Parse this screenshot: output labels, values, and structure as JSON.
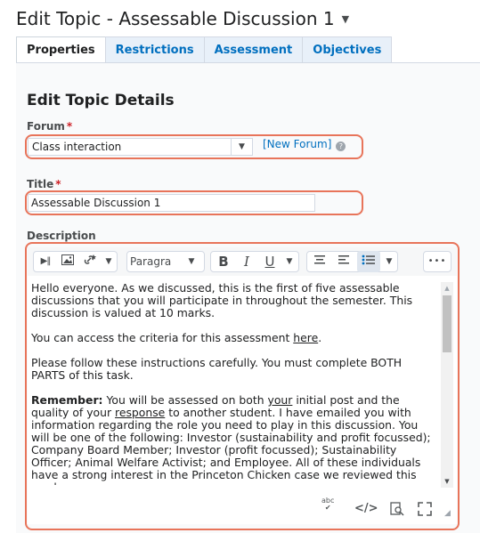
{
  "page": {
    "title": "Edit Topic - Assessable Discussion 1",
    "title_caret": "▼"
  },
  "tabs": [
    {
      "label": "Properties",
      "active": true
    },
    {
      "label": "Restrictions",
      "active": false
    },
    {
      "label": "Assessment",
      "active": false
    },
    {
      "label": "Objectives",
      "active": false
    }
  ],
  "section": {
    "heading": "Edit Topic Details"
  },
  "forum": {
    "label": "Forum",
    "required_mark": "*",
    "selected": "Class interaction",
    "new_forum_link": "[New Forum]",
    "help_glyph": "?"
  },
  "title_field": {
    "label": "Title",
    "required_mark": "*",
    "value": "Assessable Discussion 1"
  },
  "description": {
    "label": "Description",
    "toolbar": {
      "paragraph_select": "Paragra",
      "bold": "B",
      "italic": "I",
      "underline": "U",
      "more": "•••"
    },
    "paragraphs": {
      "p1": "Hello everyone. As we discussed, this is the first of five assessable discussions that you will participate in throughout the semester. This discussion is valued at 10 marks.",
      "p2_before": "You can access the criteria for this assessment ",
      "p2_link": "here",
      "p2_after": ".",
      "p3": "Please follow these instructions carefully. You must complete BOTH PARTS of this task.",
      "p4_bold": "Remember:",
      "p4_a": " You will be assessed on both ",
      "p4_your": "your",
      "p4_b": " initial post and the quality of your ",
      "p4_response": "response",
      "p4_c": " to another student. I have emailed you with information regarding the role you need to play in this discussion. You will be one of the following: Investor (sustainability and profit focussed); Company Board Member; Investor (profit focussed); Sustainability Officer; Animal Welfare Activist; and Employee. All of these individuals have a strong interest in the Princeton Chicken case we reviewed this week."
    },
    "status": {
      "spellcheck_label": "abc"
    }
  },
  "colors": {
    "highlight": "#e8745a",
    "link": "#006fbf",
    "required": "#cd2026"
  }
}
